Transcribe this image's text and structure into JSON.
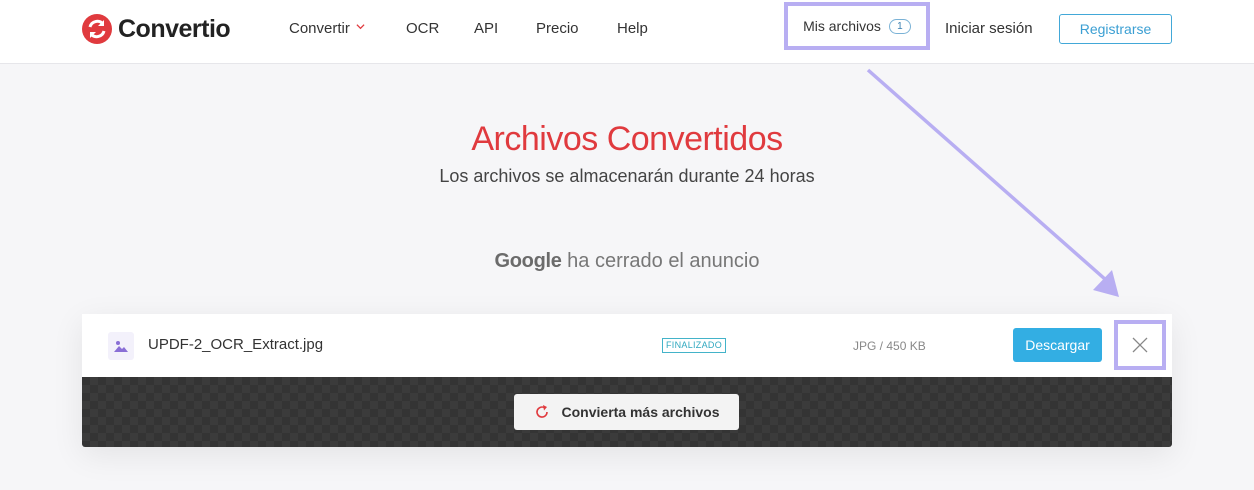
{
  "header": {
    "logo_text": "Convertio",
    "nav": [
      {
        "label": "Convertir",
        "has_dropdown": true
      },
      {
        "label": "OCR"
      },
      {
        "label": "API"
      },
      {
        "label": "Precio"
      },
      {
        "label": "Help"
      }
    ],
    "my_files_label": "Mis archivos",
    "my_files_count": "1",
    "login_label": "Iniciar sesión",
    "register_label": "Registrarse"
  },
  "hero": {
    "title": "Archivos Convertidos",
    "subtitle": "Los archivos se almacenarán durante 24 horas"
  },
  "ad": {
    "brand": "Google",
    "message": "ha cerrado el anuncio"
  },
  "file": {
    "icon": "image-file-icon",
    "name": "UPDF-2_OCR_Extract.jpg",
    "status": "FINALIZADO",
    "meta": "JPG / 450 KB",
    "download_label": "Descargar",
    "remove_icon": "close-icon"
  },
  "convert_more": {
    "icon": "refresh-icon",
    "label": "Convierta más archivos"
  },
  "colors": {
    "brand_red": "#e03a3e",
    "accent_blue": "#33aee3",
    "highlight_purple": "#b8aef2",
    "status_teal": "#2fa8bf"
  }
}
